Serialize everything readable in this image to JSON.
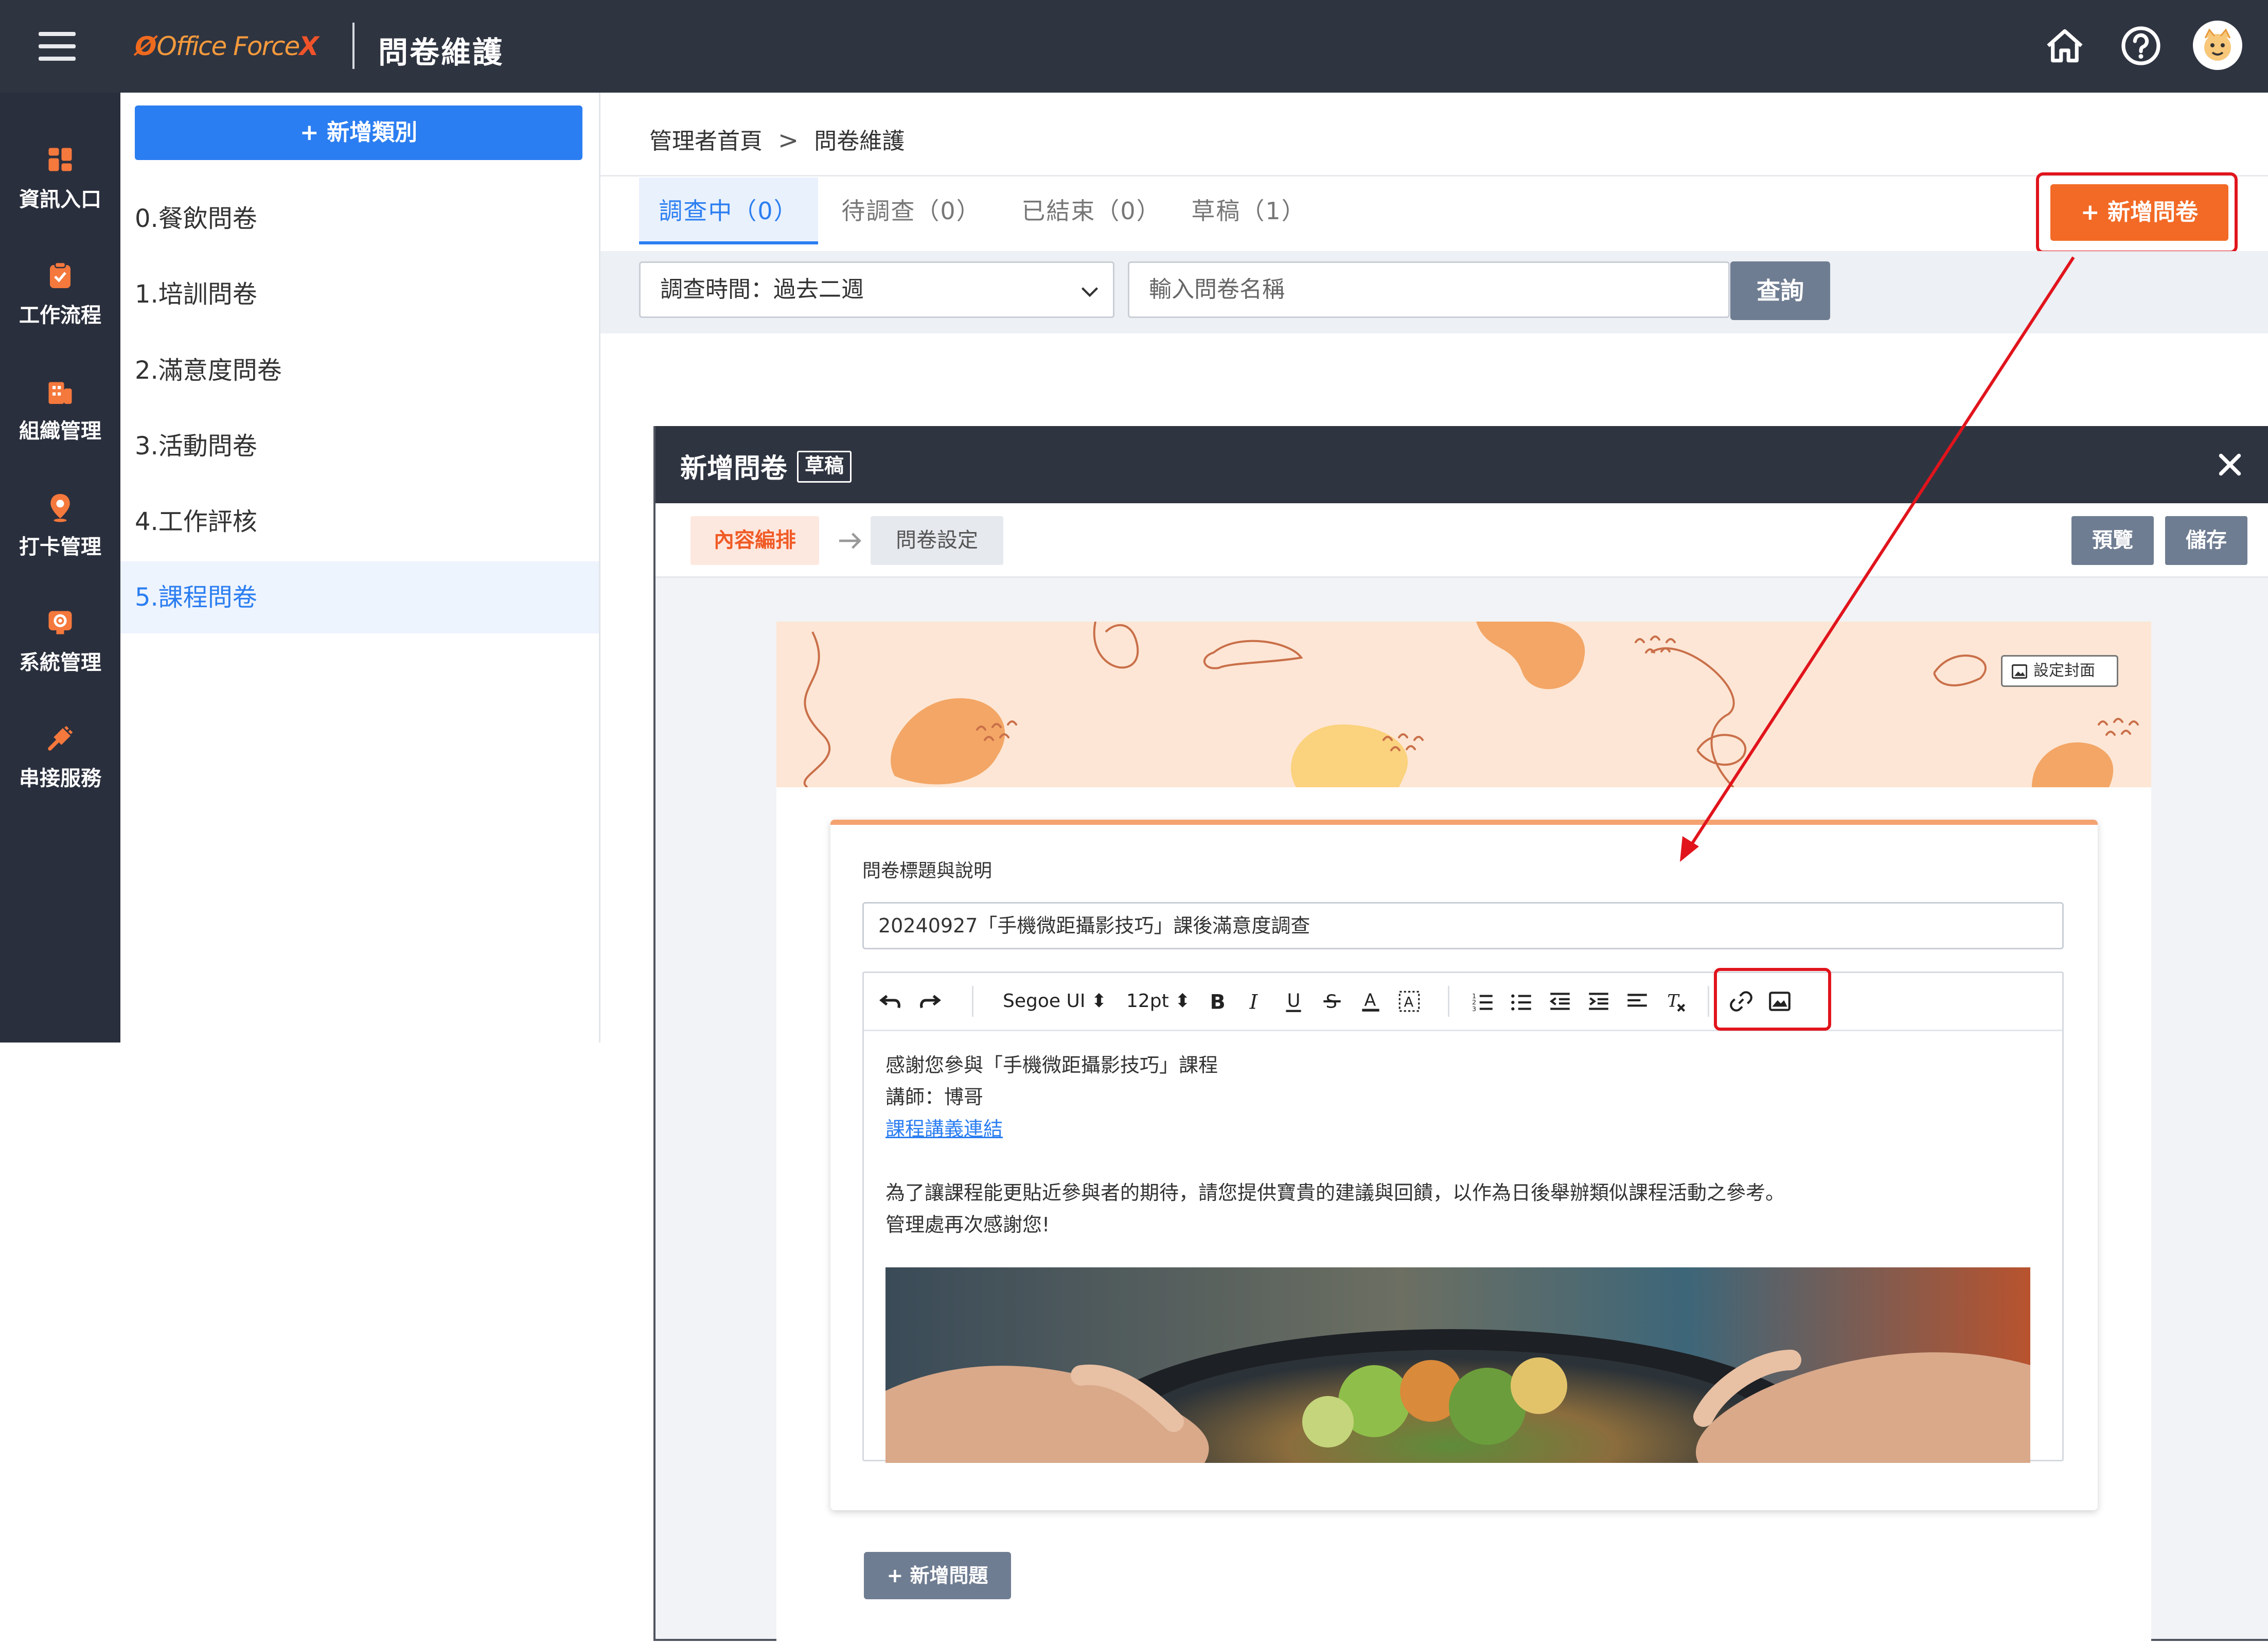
{
  "header": {
    "logo_mark": "Ø",
    "logo_text": "Office Force",
    "logo_x": "X",
    "title": "問卷維護"
  },
  "icons": {
    "menu": "hamburger-icon",
    "home": "home-icon",
    "help": "help-icon",
    "avatar": "avatar"
  },
  "left_nav": [
    {
      "label": "資訊入口",
      "icon": "dashboard-icon",
      "color": "#f5783c"
    },
    {
      "label": "工作流程",
      "icon": "clipboard-icon",
      "color": "#f5783c"
    },
    {
      "label": "組織管理",
      "icon": "building-icon",
      "color": "#f5783c"
    },
    {
      "label": "打卡管理",
      "icon": "location-pin-icon",
      "color": "#f5783c"
    },
    {
      "label": "系統管理",
      "icon": "settings-icon",
      "color": "#f5783c"
    },
    {
      "label": "串接服務",
      "icon": "plug-icon",
      "color": "#f5783c"
    }
  ],
  "categories": {
    "add_button": "+ 新增類別",
    "items": [
      "0.餐飲問卷",
      "1.培訓問卷",
      "2.滿意度問卷",
      "3.活動問卷",
      "4.工作評核",
      "5.課程問卷"
    ],
    "active_index": 5
  },
  "breadcrumb": {
    "home": "管理者首頁",
    "separator": ">",
    "current": "問卷維護"
  },
  "tabs": [
    {
      "label": "調查中（0）",
      "active": true
    },
    {
      "label": "待調查（0）",
      "active": false
    },
    {
      "label": "已結束（0）",
      "active": false
    },
    {
      "label": "草稿（1）",
      "active": false
    }
  ],
  "new_survey_button": "+ 新增問卷",
  "filter": {
    "period_value": "調查時間：過去二週",
    "search_placeholder": "輸入問卷名稱",
    "query_button": "查詢"
  },
  "modal": {
    "title": "新增問卷",
    "badge": "草稿",
    "step1": "內容編排",
    "step2": "問卷設定",
    "preview_button": "預覽",
    "save_button": "儲存",
    "set_cover_button": "設定封面",
    "section_label": "問卷標題與說明",
    "title_value": "20240927「手機微距攝影技巧」課後滿意度調查",
    "toolbar": {
      "font_family": "Segoe UI",
      "font_size": "12pt"
    },
    "content": {
      "line1": "感謝您參與「手機微距攝影技巧」課程",
      "line2": "講師：博哥",
      "link_text": "課程講義連結",
      "line4": "為了讓課程能更貼近參與者的期待，請您提供寶貴的建議與回饋，以作為日後舉辦類似課程活動之參考。",
      "line5": "管理處再次感謝您!"
    },
    "add_question_button": "+ 新增問題"
  },
  "colors": {
    "accent_blue": "#2b7ef1",
    "accent_orange": "#f26a26",
    "header_dark": "#2f3441",
    "annotation_red": "#e1141c"
  }
}
